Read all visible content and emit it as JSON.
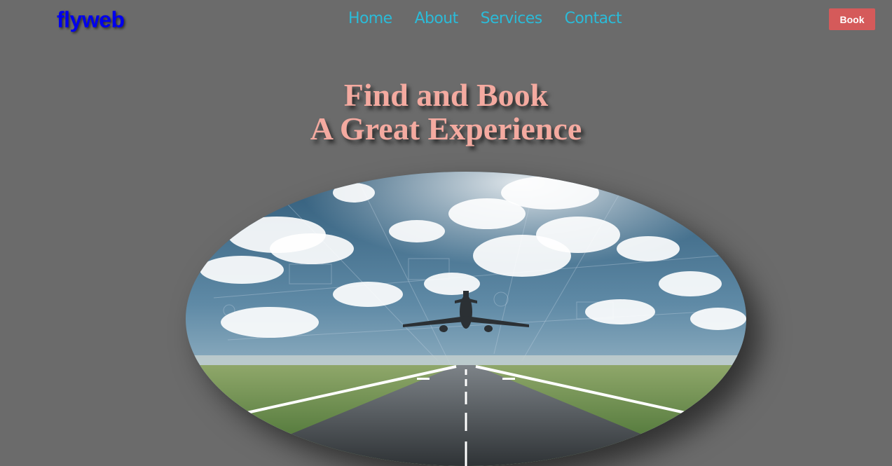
{
  "nav": {
    "logo": "flyweb",
    "links": [
      "Home",
      "About",
      "Services",
      "Contact"
    ],
    "book_label": "Book"
  },
  "hero": {
    "title_line1": "Find and Book",
    "title_line2": "A Great Experience",
    "image_subject": "airplane taking off from runway under cloudy sky"
  },
  "colors": {
    "page_bg": "#6b6b6b",
    "logo": "#0000ee",
    "nav_link": "#2bbbd8",
    "book_button": "#d55a5a",
    "hero_title": "#f4aaa0"
  }
}
